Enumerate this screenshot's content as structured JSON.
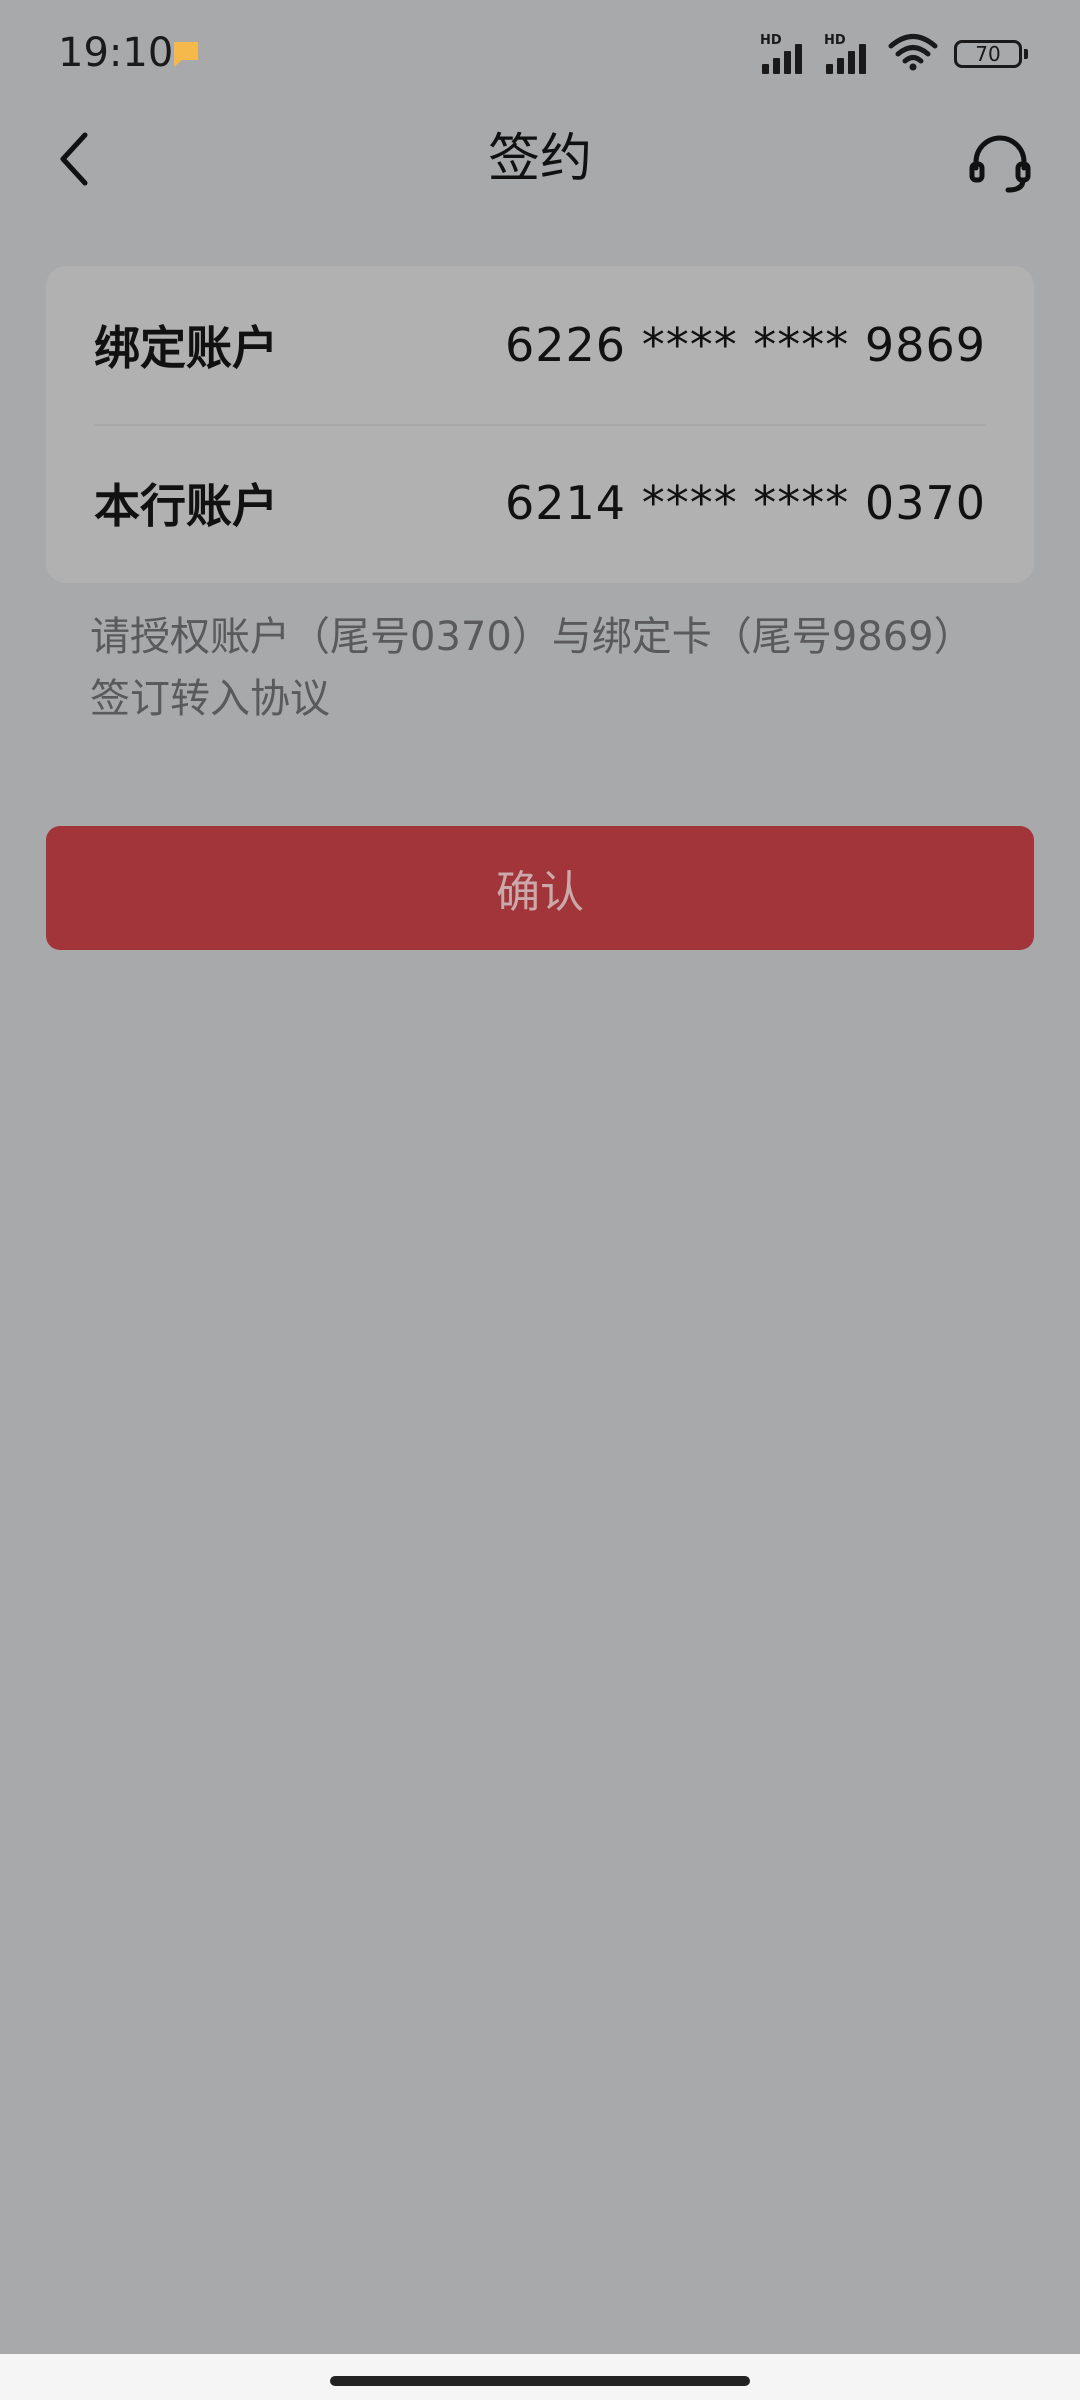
{
  "status_bar": {
    "time": "19:10",
    "battery_level": "70",
    "network_badge_1": "HD",
    "network_badge_2": "HD",
    "icons": [
      "notification-icon",
      "signal-icon",
      "signal-icon",
      "wifi-icon",
      "battery-icon"
    ],
    "notification_color": "#f5b84a"
  },
  "header": {
    "title": "签约",
    "back_icon": "chevron-left-icon",
    "service_icon": "headset-icon"
  },
  "accounts": [
    {
      "label": "绑定账户",
      "value": "6226 **** **** 9869"
    },
    {
      "label": "本行账户",
      "value": "6214 **** **** 0370"
    }
  ],
  "info": {
    "line1": "请授权账户（尾号0370）与绑定卡（尾号9869）",
    "line2": "签订转入协议"
  },
  "actions": {
    "confirm_label": "确认",
    "confirm_color": "#a2353a"
  },
  "colors": {
    "background": "#a8a9ab",
    "card": "#b1b1b2"
  }
}
